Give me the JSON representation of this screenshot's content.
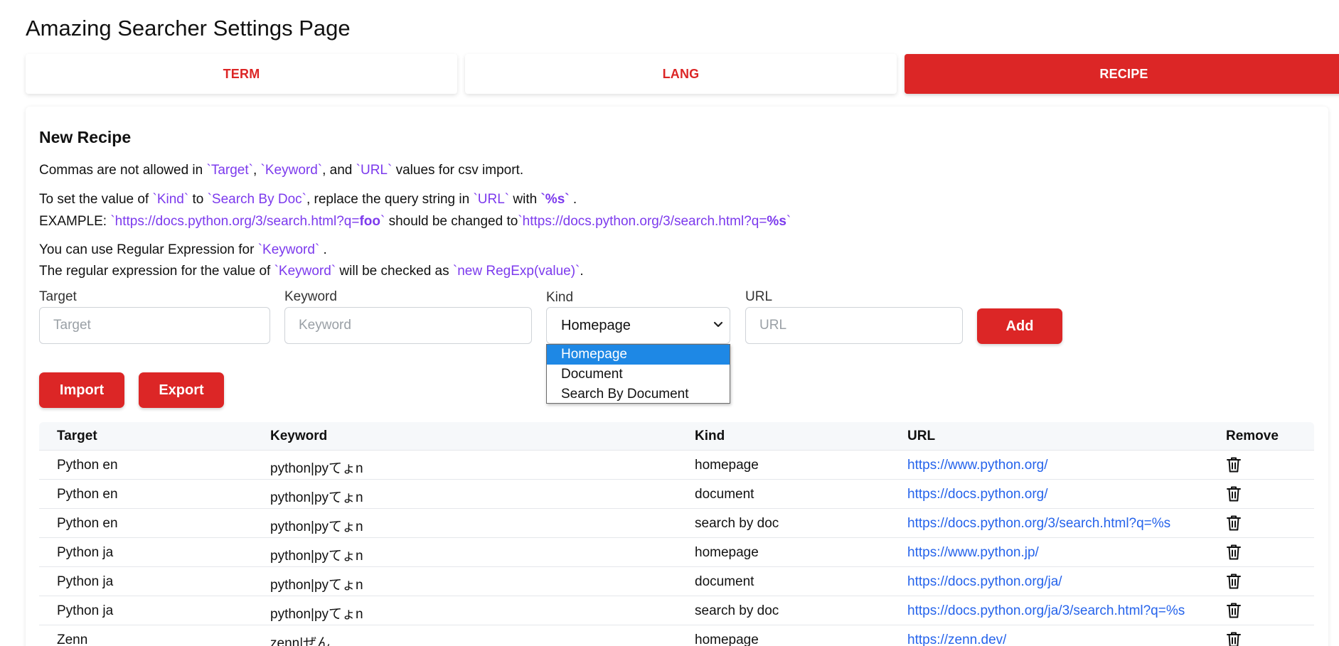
{
  "page_title": "Amazing Searcher Settings Page",
  "tabs": [
    {
      "label": "TERM",
      "active": false
    },
    {
      "label": "LANG",
      "active": false
    },
    {
      "label": "RECIPE",
      "active": true
    }
  ],
  "accent_color": "#dc2626",
  "code_color": "#7c3aed",
  "link_color": "#2563eb",
  "section_title": "New Recipe",
  "help": {
    "line1": {
      "t1": "Commas are not allowed in ",
      "c1": "`Target`",
      "t2": ", ",
      "c2": "`Keyword`",
      "t3": ", and ",
      "c3": "`URL`",
      "t4": " values for csv import."
    },
    "line2": {
      "t1": "To set the value of ",
      "c1": "`Kind`",
      "t2": " to ",
      "c2": "`Search By Doc`",
      "t3": ", replace the query string in ",
      "c3": "`URL`",
      "t4": " with ",
      "c4": "`%s`",
      "t5": " ."
    },
    "line3": {
      "t1": "EXAMPLE: ",
      "c1a": "`https://docs.python.org/3/search.html?q=",
      "c1b": "foo",
      "c1c": "`",
      "t2": " should be changed to",
      "c2a": "`https://docs.python.org/3/search.html?q=",
      "c2b": "%s",
      "c2c": "`"
    },
    "line4": {
      "t1": "You can use Regular Expression for ",
      "c1": "`Keyword`",
      "t2": " ."
    },
    "line5": {
      "t1": "The regular expression for the value of ",
      "c1": "`Keyword`",
      "t2": " will be checked as ",
      "c2": "`new RegExp(value)`",
      "t3": "."
    }
  },
  "form": {
    "target": {
      "label": "Target",
      "placeholder": "Target",
      "value": ""
    },
    "keyword": {
      "label": "Keyword",
      "placeholder": "Keyword",
      "value": ""
    },
    "kind": {
      "label": "Kind",
      "selected": "Homepage",
      "options": [
        "Homepage",
        "Document",
        "Search By Document"
      ],
      "dropdown_open": true
    },
    "url": {
      "label": "URL",
      "placeholder": "URL",
      "value": ""
    },
    "add_label": "Add"
  },
  "import_label": "Import",
  "export_label": "Export",
  "table": {
    "headers": {
      "target": "Target",
      "keyword": "Keyword",
      "kind": "Kind",
      "url": "URL",
      "remove": "Remove"
    },
    "rows": [
      {
        "target": "Python en",
        "keyword": "python|pyてょn",
        "kind": "homepage",
        "url": "https://www.python.org/"
      },
      {
        "target": "Python en",
        "keyword": "python|pyてょn",
        "kind": "document",
        "url": "https://docs.python.org/"
      },
      {
        "target": "Python en",
        "keyword": "python|pyてょn",
        "kind": "search by doc",
        "url": "https://docs.python.org/3/search.html?q=%s"
      },
      {
        "target": "Python ja",
        "keyword": "python|pyてょn",
        "kind": "homepage",
        "url": "https://www.python.jp/"
      },
      {
        "target": "Python ja",
        "keyword": "python|pyてょn",
        "kind": "document",
        "url": "https://docs.python.org/ja/"
      },
      {
        "target": "Python ja",
        "keyword": "python|pyてょn",
        "kind": "search by doc",
        "url": "https://docs.python.org/ja/3/search.html?q=%s"
      },
      {
        "target": "Zenn",
        "keyword": "zenn|ぜん",
        "kind": "homepage",
        "url": "https://zenn.dev/"
      }
    ],
    "remove_icon": "trash-icon"
  }
}
